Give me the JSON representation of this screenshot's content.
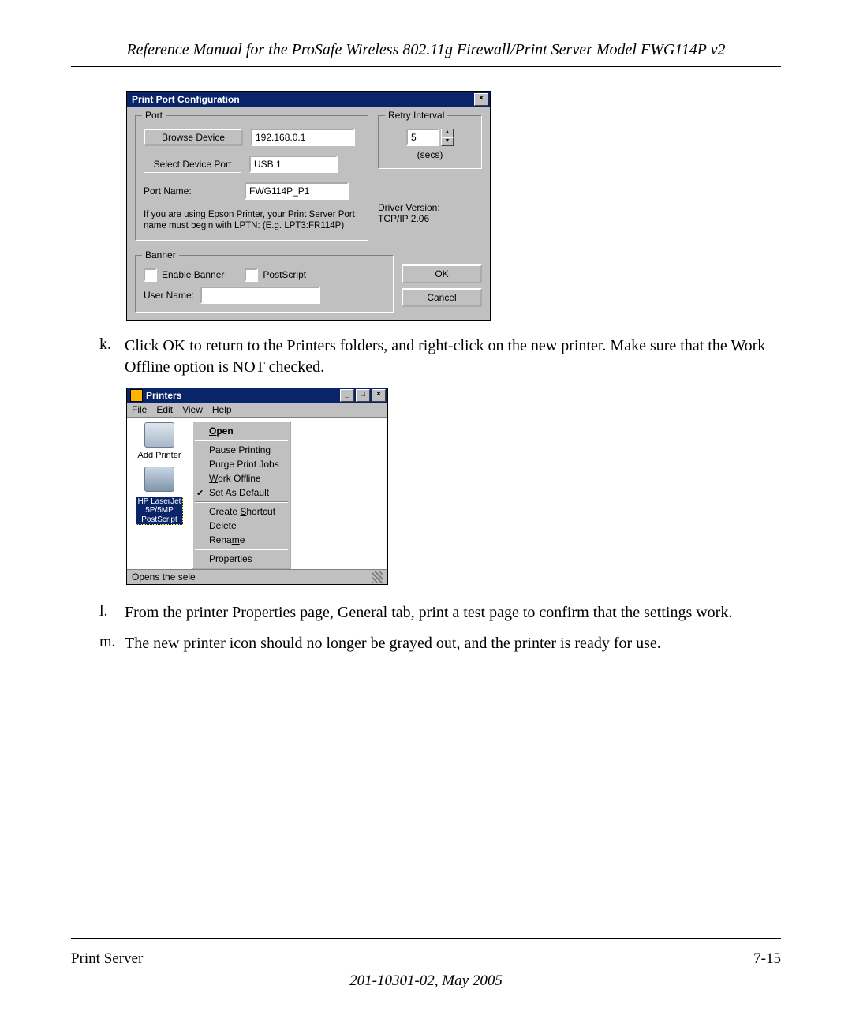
{
  "header": {
    "title": "Reference Manual for the ProSafe Wireless 802.11g  Firewall/Print Server Model FWG114P v2"
  },
  "dialog1": {
    "title": "Print Port Configuration",
    "close_glyph": "×",
    "port": {
      "legend": "Port",
      "browse_btn": "Browse Device",
      "ip_value": "192.168.0.1",
      "select_btn": "Select Device Port",
      "device_port_value": "USB 1",
      "port_name_label": "Port Name:",
      "port_name_value": "FWG114P_P1",
      "note": "If you are using Epson Printer, your Print Server Port name must begin with LPTN: (E.g. LPT3:FR114P)"
    },
    "retry": {
      "legend": "Retry Interval",
      "value": "5",
      "unit": "(secs)"
    },
    "driver": {
      "label": "Driver Version:",
      "value": "TCP/IP 2.06"
    },
    "banner": {
      "legend": "Banner",
      "enable_label": "Enable Banner",
      "postscript_label": "PostScript",
      "username_label": "User Name:",
      "username_value": ""
    },
    "buttons": {
      "ok": "OK",
      "cancel": "Cancel"
    }
  },
  "steps": {
    "k": {
      "marker": "k.",
      "text": "Click OK to return to the Printers folders, and right-click on the new printer. Make sure that the Work Offline option is NOT checked."
    },
    "l": {
      "marker": "l.",
      "text": "From the printer Properties page, General tab, print a test page to confirm that the settings work."
    },
    "m": {
      "marker": "m.",
      "text": "The new printer icon should no longer be grayed out, and the printer is ready for use."
    }
  },
  "dialog2": {
    "title": "Printers",
    "min_glyph": "_",
    "max_glyph": "□",
    "close_glyph": "×",
    "menubar": {
      "file": "File",
      "edit": "Edit",
      "view": "View",
      "help": "Help"
    },
    "printers": {
      "add_label": "Add Printer",
      "selected_label_line1": "HP LaserJet",
      "selected_label_line2": "5P/5MP",
      "selected_label_line3": "PostScript"
    },
    "context_menu": {
      "open": "Open",
      "pause": "Pause Printing",
      "purge": "Purge Print Jobs",
      "offline": "Work Offline",
      "default": "Set As Default",
      "shortcut": "Create Shortcut",
      "delete": "Delete",
      "rename": "Rename",
      "properties": "Properties"
    },
    "statusbar": "Opens the sele"
  },
  "footer": {
    "left": "Print Server",
    "right": "7-15",
    "date": "201-10301-02, May 2005"
  }
}
